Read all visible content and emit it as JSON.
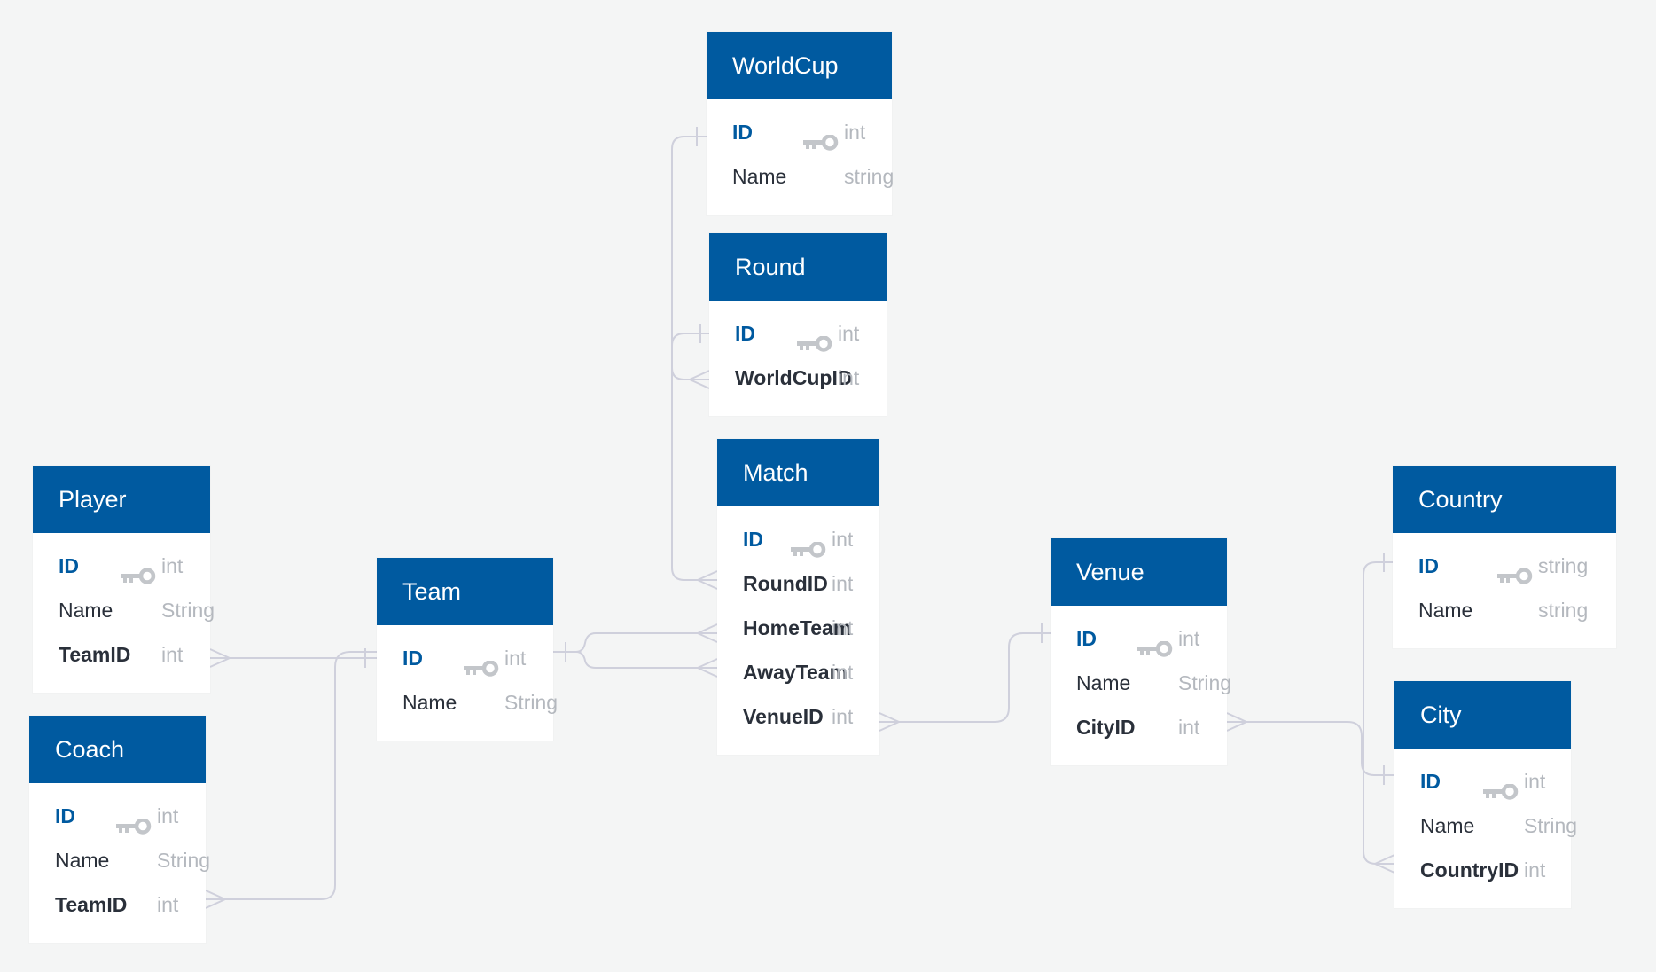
{
  "diagram": {
    "type": "entity-relationship",
    "colors": {
      "header": "#005aa0",
      "primary_key": "#005aa0",
      "field_name": "#2a303a",
      "field_type": "#b4b8be",
      "connector": "#cfd0dc",
      "background": "#f4f5f5"
    },
    "entities": {
      "worldcup": {
        "name": "WorldCup",
        "fields": [
          {
            "name": "ID",
            "type": "int",
            "key": "primary"
          },
          {
            "name": "Name",
            "type": "string",
            "key": ""
          }
        ]
      },
      "round": {
        "name": "Round",
        "fields": [
          {
            "name": "ID",
            "type": "int",
            "key": "primary"
          },
          {
            "name": "WorldCupID",
            "type": "int",
            "key": "foreign"
          }
        ]
      },
      "match": {
        "name": "Match",
        "fields": [
          {
            "name": "ID",
            "type": "int",
            "key": "primary"
          },
          {
            "name": "RoundID",
            "type": "int",
            "key": "foreign"
          },
          {
            "name": "HomeTeam",
            "type": "int",
            "key": "foreign"
          },
          {
            "name": "AwayTeam",
            "type": "int",
            "key": "foreign"
          },
          {
            "name": "VenueID",
            "type": "int",
            "key": "foreign"
          }
        ]
      },
      "player": {
        "name": "Player",
        "fields": [
          {
            "name": "ID",
            "type": "int",
            "key": "primary"
          },
          {
            "name": "Name",
            "type": "String",
            "key": ""
          },
          {
            "name": "TeamID",
            "type": "int",
            "key": "foreign"
          }
        ]
      },
      "coach": {
        "name": "Coach",
        "fields": [
          {
            "name": "ID",
            "type": "int",
            "key": "primary"
          },
          {
            "name": "Name",
            "type": "String",
            "key": ""
          },
          {
            "name": "TeamID",
            "type": "int",
            "key": "foreign"
          }
        ]
      },
      "team": {
        "name": "Team",
        "fields": [
          {
            "name": "ID",
            "type": "int",
            "key": "primary"
          },
          {
            "name": "Name",
            "type": "String",
            "key": ""
          }
        ]
      },
      "venue": {
        "name": "Venue",
        "fields": [
          {
            "name": "ID",
            "type": "int",
            "key": "primary"
          },
          {
            "name": "Name",
            "type": "String",
            "key": ""
          },
          {
            "name": "CityID",
            "type": "int",
            "key": "foreign"
          }
        ]
      },
      "country": {
        "name": "Country",
        "fields": [
          {
            "name": "ID",
            "type": "string",
            "key": "primary"
          },
          {
            "name": "Name",
            "type": "string",
            "key": ""
          }
        ]
      },
      "city": {
        "name": "City",
        "fields": [
          {
            "name": "ID",
            "type": "int",
            "key": "primary"
          },
          {
            "name": "Name",
            "type": "String",
            "key": ""
          },
          {
            "name": "CountryID",
            "type": "int",
            "key": "foreign"
          }
        ]
      }
    },
    "relationships": [
      {
        "from": "Round.WorldCupID",
        "to": "WorldCup.ID",
        "cardinality": "many-to-one"
      },
      {
        "from": "Match.RoundID",
        "to": "Round.ID",
        "cardinality": "many-to-one"
      },
      {
        "from": "Match.HomeTeam",
        "to": "Team.ID",
        "cardinality": "many-to-one"
      },
      {
        "from": "Match.AwayTeam",
        "to": "Team.ID",
        "cardinality": "many-to-one"
      },
      {
        "from": "Match.VenueID",
        "to": "Venue.ID",
        "cardinality": "many-to-one"
      },
      {
        "from": "Player.TeamID",
        "to": "Team.ID",
        "cardinality": "many-to-one"
      },
      {
        "from": "Coach.TeamID",
        "to": "Team.ID",
        "cardinality": "many-to-one"
      },
      {
        "from": "Venue.CityID",
        "to": "City.ID",
        "cardinality": "many-to-one"
      },
      {
        "from": "City.CountryID",
        "to": "Country.ID",
        "cardinality": "many-to-one"
      }
    ]
  }
}
